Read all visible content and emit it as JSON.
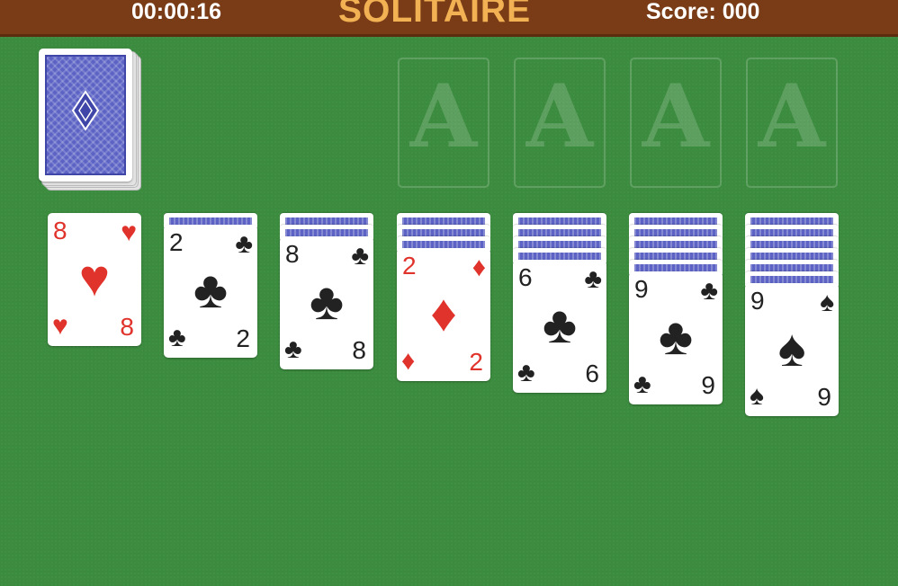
{
  "header": {
    "timer": "00:00:16",
    "title": "SOLITAIRE",
    "score": "Score: 000"
  },
  "foundations": [
    {
      "label": "A"
    },
    {
      "label": "A"
    },
    {
      "label": "A"
    },
    {
      "label": "A"
    }
  ],
  "tableau": [
    {
      "facedown": 0,
      "card": {
        "rank": "8",
        "suit": "♥",
        "suit_name": "hearts",
        "color": "red"
      }
    },
    {
      "facedown": 1,
      "card": {
        "rank": "2",
        "suit": "♣",
        "suit_name": "clubs",
        "color": "black"
      }
    },
    {
      "facedown": 2,
      "card": {
        "rank": "8",
        "suit": "♣",
        "suit_name": "clubs",
        "color": "black"
      }
    },
    {
      "facedown": 3,
      "card": {
        "rank": "2",
        "suit": "♦",
        "suit_name": "diamonds",
        "color": "red"
      }
    },
    {
      "facedown": 4,
      "card": {
        "rank": "6",
        "suit": "♣",
        "suit_name": "clubs",
        "color": "black"
      }
    },
    {
      "facedown": 5,
      "card": {
        "rank": "9",
        "suit": "♣",
        "suit_name": "clubs",
        "color": "black"
      }
    },
    {
      "facedown": 6,
      "card": {
        "rank": "9",
        "suit": "♠",
        "suit_name": "spades",
        "color": "black"
      }
    }
  ],
  "colors": {
    "felt": "#3c8c3f",
    "header_bar": "#7a3c17",
    "title": "#f2b153",
    "card_back": "#5c63c4",
    "red_suit": "#e0332b",
    "black_suit": "#222222"
  }
}
